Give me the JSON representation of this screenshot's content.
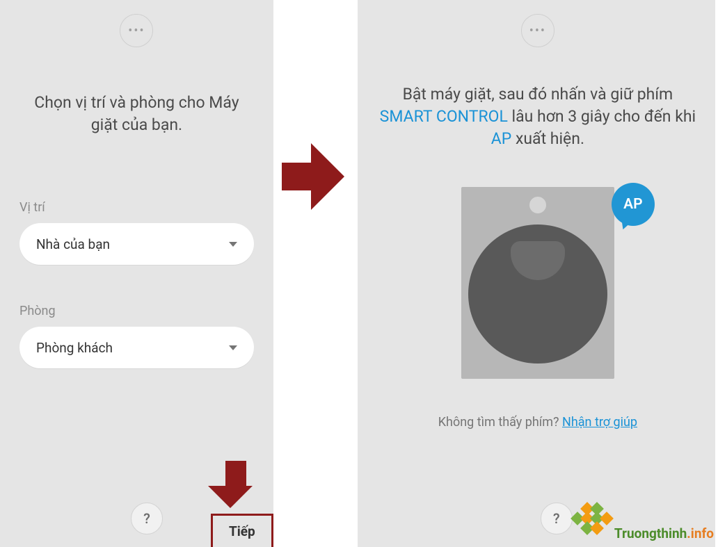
{
  "left": {
    "title": "Chọn vị trí và phòng cho Máy giặt của bạn.",
    "location_label": "Vị trí",
    "location_value": "Nhà của bạn",
    "room_label": "Phòng",
    "room_value": "Phòng khách",
    "help_icon": "?",
    "next_label": "Tiếp"
  },
  "right": {
    "title_part1": "Bật máy giặt, sau đó nhấn và giữ phím ",
    "title_highlight1": "SMART CONTROL",
    "title_part2": " lâu hơn 3 giây cho đến khi ",
    "title_highlight2": "AP",
    "title_part3": " xuất hiện.",
    "ap_badge": "AP",
    "help_text": "Không tìm thấy phím? ",
    "help_link": "Nhận trợ giúp",
    "help_icon": "?"
  },
  "brand": {
    "name1": "Truongthinh",
    "name2": ".info"
  }
}
